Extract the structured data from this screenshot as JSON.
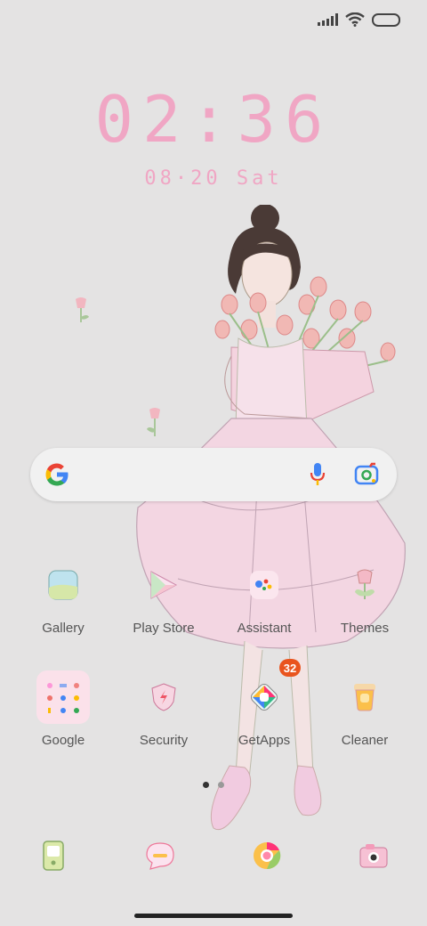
{
  "clock": {
    "time": "02:36",
    "date": "08·20  Sat"
  },
  "apps_row1": [
    {
      "name": "gallery",
      "label": "Gallery",
      "icon": "gallery-icon"
    },
    {
      "name": "play-store",
      "label": "Play Store",
      "icon": "play-store-icon"
    },
    {
      "name": "assistant",
      "label": "Assistant",
      "icon": "assistant-icon"
    },
    {
      "name": "themes",
      "label": "Themes",
      "icon": "tulip-icon"
    }
  ],
  "apps_row2": [
    {
      "name": "google",
      "label": "Google",
      "icon": "folder-icon"
    },
    {
      "name": "security",
      "label": "Security",
      "icon": "shield-icon"
    },
    {
      "name": "getapps",
      "label": "GetApps",
      "icon": "getapps-icon",
      "badge": "32"
    },
    {
      "name": "cleaner",
      "label": "Cleaner",
      "icon": "trash-icon"
    }
  ],
  "dock": [
    {
      "name": "phone",
      "icon": "phone-icon"
    },
    {
      "name": "messages",
      "icon": "message-icon"
    },
    {
      "name": "browser",
      "icon": "browser-icon"
    },
    {
      "name": "camera",
      "icon": "camera-icon"
    }
  ],
  "colors": {
    "accent_pink": "#f0a6c4",
    "badge": "#e9541e"
  }
}
